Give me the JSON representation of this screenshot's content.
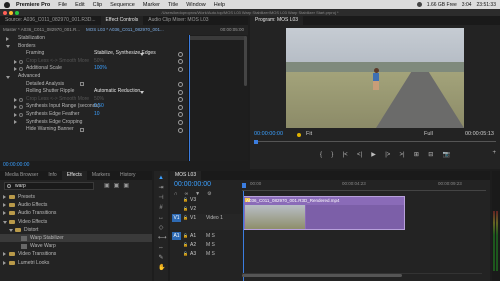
{
  "menubar": {
    "items": [
      "Premiere Pro",
      "File",
      "Edit",
      "Clip",
      "Sequence",
      "Marker",
      "Title",
      "Window",
      "Help"
    ],
    "status": [
      "1.66 GB Free",
      "3:04",
      "23:51:33"
    ]
  },
  "window": {
    "title": "/Users/kedopropros/Work/Auto.top/MOS L03 Warp Stabilizer/MOS L03 Warp Stabilizer Start.prproj *"
  },
  "effect_controls": {
    "tabs": [
      "Source: A036_C011_082970_001.R3D...",
      "Effect Controls",
      "Audio Clip Mixer: MOS L03"
    ],
    "source": "Master * A036_C011_082970_001.R...",
    "clip": "MOS L03 * A036_C011_082970_001...",
    "timecode_top": "00:00:05:00",
    "rows": [
      {
        "label": "Stabilization",
        "value": "",
        "indent": 1,
        "tri": "right",
        "icon": "none"
      },
      {
        "label": "Borders",
        "value": "",
        "indent": 1,
        "tri": "down",
        "icon": "none"
      },
      {
        "label": "Framing",
        "value": "Stabilize, Synthesize Edges",
        "indent": 2,
        "tri": "none",
        "icon": "none",
        "style": "white",
        "dropdown": true,
        "reset": true
      },
      {
        "label": "Crop Less <-> Smooth More",
        "value": "50%",
        "indent": 2,
        "tri": "right",
        "icon": "stopwatch",
        "style": "dim",
        "reset": true
      },
      {
        "label": "Additional Scale",
        "value": "100%",
        "indent": 2,
        "tri": "right",
        "icon": "stopwatch",
        "style": "blue",
        "reset": true
      },
      {
        "label": "Advanced",
        "value": "",
        "indent": 1,
        "tri": "down",
        "icon": "none"
      },
      {
        "label": "Detailed Analysis",
        "value": "",
        "indent": 2,
        "tri": "none",
        "icon": "checkbox",
        "reset": true
      },
      {
        "label": "Rolling Shutter Ripple",
        "value": "Automatic Reduction",
        "indent": 2,
        "tri": "none",
        "icon": "none",
        "style": "white",
        "dropdown": true,
        "reset": true
      },
      {
        "label": "Crop Less <-> Smooth More",
        "value": "50%",
        "indent": 2,
        "tri": "right",
        "icon": "stopwatch",
        "style": "dim",
        "reset": true
      },
      {
        "label": "Synthesis Input Range (seconds)",
        "value": "0.50",
        "indent": 2,
        "tri": "right",
        "icon": "stopwatch",
        "style": "blue",
        "reset": true
      },
      {
        "label": "Synthesis Edge Feather",
        "value": "10",
        "indent": 2,
        "tri": "right",
        "icon": "stopwatch",
        "style": "blue",
        "reset": true
      },
      {
        "label": "Synthesis Edge Cropping",
        "value": "",
        "indent": 2,
        "tri": "right",
        "icon": "none",
        "reset": true
      },
      {
        "label": "Hide Warning Banner",
        "value": "",
        "indent": 2,
        "tri": "none",
        "icon": "checkbox",
        "reset": true
      }
    ],
    "timecode_bottom": "00:00:00:00"
  },
  "program_monitor": {
    "tab": "Program: MOS L03",
    "timecode_left": "00:00:00:00",
    "fit": "Fit",
    "resolution": "Full",
    "timecode_right": "00:00:05:13",
    "transport": [
      "{",
      "}",
      "|<",
      "<|",
      "▶",
      "|>",
      ">|",
      "⊞",
      "⊟",
      "📷"
    ]
  },
  "project_panel": {
    "tabs": [
      "Media Browser",
      "Info",
      "Effects",
      "Markers",
      "History"
    ],
    "search_value": "warp",
    "tree": [
      {
        "label": "Presets",
        "indent": 1,
        "tri": "right",
        "icon": "folder"
      },
      {
        "label": "Audio Effects",
        "indent": 1,
        "tri": "right",
        "icon": "folder"
      },
      {
        "label": "Audio Transitions",
        "indent": 1,
        "tri": "right",
        "icon": "folder"
      },
      {
        "label": "Video Effects",
        "indent": 1,
        "tri": "down",
        "icon": "folder"
      },
      {
        "label": "Distort",
        "indent": 2,
        "tri": "down",
        "icon": "folder"
      },
      {
        "label": "Warp Stabilizer",
        "indent": 3,
        "tri": "none",
        "icon": "fx",
        "selected": true
      },
      {
        "label": "Wave Warp",
        "indent": 3,
        "tri": "none",
        "icon": "fx"
      },
      {
        "label": "Video Transitions",
        "indent": 1,
        "tri": "right",
        "icon": "folder"
      },
      {
        "label": "Lumetri Looks",
        "indent": 1,
        "tri": "right",
        "icon": "folder"
      }
    ]
  },
  "timeline": {
    "tab": "MOS L03",
    "timecode": "00:00:00:00",
    "ruler_marks": [
      "00:00",
      "00:00:04:23",
      "00:00:09:23"
    ],
    "tracks": [
      {
        "target": "",
        "name": "V3",
        "label": ""
      },
      {
        "target": "",
        "name": "V2",
        "label": ""
      },
      {
        "target": "V1",
        "name": "V1",
        "label": "Video 1"
      },
      {
        "target": "A1",
        "name": "A1",
        "label": "M S"
      },
      {
        "target": "",
        "name": "A2",
        "label": "M S"
      },
      {
        "target": "",
        "name": "A3",
        "label": "M S"
      }
    ],
    "clip_label": "A036_C011_082970_001.R3D_Rendered.mp4"
  }
}
